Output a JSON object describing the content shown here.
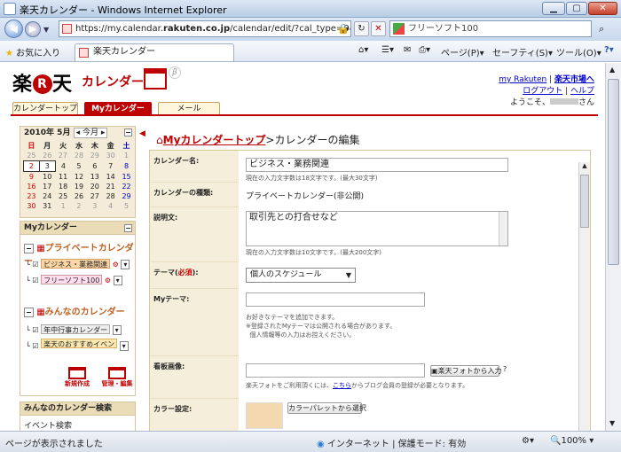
{
  "window": {
    "title": "楽天カレンダー - Windows Internet Explorer"
  },
  "address": {
    "url_prefix": "https://my.calendar.",
    "url_domain": "rakuten.co.jp",
    "url_suffix": "/calendar/edit/?cal_type=0&cal",
    "search_text": "フリーソフト100"
  },
  "command": {
    "favorites": "お気に入り",
    "tab_title": "楽天カレンダー",
    "page_menu": "ページ(P)",
    "safety_menu": "セーフティ(S)",
    "tools_menu": "ツール(O)"
  },
  "site": {
    "logo_left": "楽",
    "logo_r": "R",
    "logo_right": "天",
    "calendar_word": "カレンダー",
    "ver": "β",
    "link_my": "my Rakuten",
    "link_ichiba": "楽天市場へ",
    "logout": "ログアウト",
    "help": "ヘルプ",
    "welcome_prefix": "ようこそ、",
    "welcome_suffix": "さん"
  },
  "tabs": [
    "カレンダートップ",
    "Myカレンダー",
    "メール"
  ],
  "mini_cal": {
    "title": "2010年 5月",
    "today_btn": "今月",
    "weekdays": [
      "日",
      "月",
      "火",
      "水",
      "木",
      "金",
      "土"
    ],
    "rows": [
      [
        "25",
        "26",
        "27",
        "28",
        "29",
        "30",
        "1"
      ],
      [
        "2",
        "3",
        "4",
        "5",
        "6",
        "7",
        "8"
      ],
      [
        "9",
        "10",
        "11",
        "12",
        "13",
        "14",
        "15"
      ],
      [
        "16",
        "17",
        "18",
        "19",
        "20",
        "21",
        "22"
      ],
      [
        "23",
        "24",
        "25",
        "26",
        "27",
        "28",
        "29"
      ],
      [
        "30",
        "31",
        "1",
        "2",
        "3",
        "4",
        "5"
      ]
    ]
  },
  "sidebar": {
    "my_calendar": "Myカレンダー",
    "private_group": "プライベートカレンダー",
    "cal1": "ビジネス・業務関連",
    "cal2": "フリーソフト100",
    "public_group": "みんなのカレンダー",
    "pub1": "年中行事カレンダー",
    "pub2": "楽天のおすすめイベント情報",
    "new_btn": "新規作成",
    "manage_btn": "管理・編集",
    "search_head": "みんなのカレンダー検索",
    "event_search": "イベント検索"
  },
  "main": {
    "breadcrumb": "Myカレンダートップ",
    "breadcrumb_sep": ">",
    "heading": "カレンダーの編集",
    "name_label": "カレンダー名:",
    "name_value": "ビジネス・業務関連",
    "name_hint": "現在の入力文字数は18文字です。(最大30文字)",
    "kind_label": "カレンダーの種類:",
    "kind_value": "プライベートカレンダー(非公開)",
    "desc_label": "説明文:",
    "desc_value": "取引先との打合せなど",
    "desc_hint": "現在の入力文字数は10文字です。(最大200文字)",
    "theme_label": "テーマ(",
    "theme_req": "必須",
    "theme_label_end": "):",
    "theme_value": "個人のスケジュール",
    "mytheme_label": "Myテーマ:",
    "mytheme_hint1": "お好きなテーマを追加できます。",
    "mytheme_hint2": "※登録されたMyテーマは公開される場合があります。",
    "mytheme_hint3": "個人情報等の入力はお控えください。",
    "banner_label": "看板画像:",
    "banner_btn": "楽天フォトから入力",
    "banner_hint_pre": "楽天フォトをご利用頂くには、",
    "banner_hint_link": "こちら",
    "banner_hint_post": "からブログ会員の登録が必要となります。",
    "color_label": "カラー設定:",
    "color_btn": "カラーパレットから選択",
    "color_value": "#f3d8b0"
  },
  "status": {
    "text": "ページが表示されました",
    "zone": "インターネット | 保護モード: 有効",
    "zoom": "100%"
  }
}
